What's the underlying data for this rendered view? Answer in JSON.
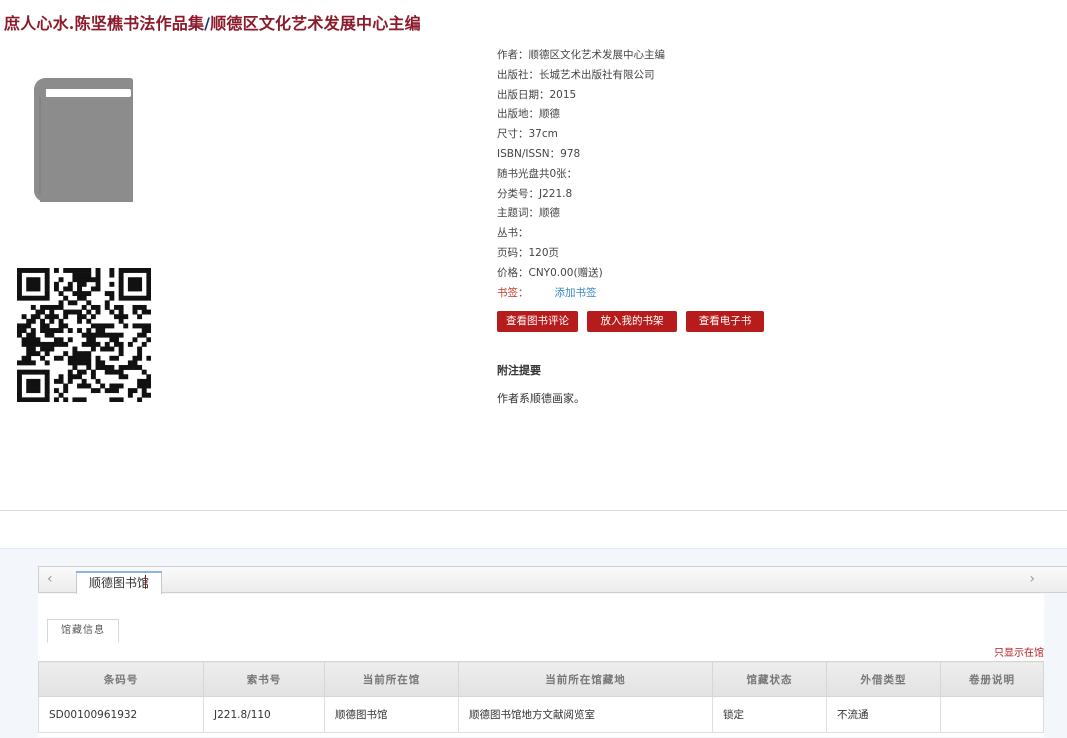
{
  "book": {
    "title_main": "庶人心水.陈坚樵书法作品集",
    "title_sep": "/",
    "title_resp": "顺德区文化艺术发展中心主编"
  },
  "meta": [
    {
      "label": "作者：",
      "value": "顺德区文化艺术发展中心主编"
    },
    {
      "label": "出版社：",
      "value": "长城艺术出版社有限公司"
    },
    {
      "label": "出版日期：",
      "value": "2015"
    },
    {
      "label": "出版地：",
      "value": "顺德"
    },
    {
      "label": "尺寸：",
      "value": "37cm"
    },
    {
      "label": "ISBN/ISSN：",
      "value": "978"
    },
    {
      "label": "随书光盘共0张：",
      "value": ""
    },
    {
      "label": "分类号：",
      "value": "J221.8"
    },
    {
      "label": "主题词：",
      "value": "顺德"
    },
    {
      "label": "丛书：",
      "value": ""
    },
    {
      "label": "页码：",
      "value": "120页"
    },
    {
      "label": "价格：",
      "value": "CNY0.00(赠送)"
    }
  ],
  "bookmark": {
    "label": "书签：",
    "link": "添加书签"
  },
  "actions": {
    "review": "查看图书评论",
    "shelf": "放入我的书架",
    "ebook": "查看电子书"
  },
  "notes": {
    "title": "附注提要",
    "text": "作者系顺德画家。"
  },
  "tabs": {
    "library": "顺德图书馆",
    "holdings": "馆藏信息",
    "only_available": "只显示在馆",
    "arrow_left": "‹",
    "arrow_right": "›"
  },
  "holdings": {
    "headers": [
      "条码号",
      "索书号",
      "当前所在馆",
      "当前所在馆藏地",
      "馆藏状态",
      "外借类型",
      "卷册说明"
    ],
    "rows": [
      [
        "SD00100961932",
        "J221.8/110",
        "顺德图书馆",
        "顺德图书馆地方文献阅览室",
        "锁定",
        "不流通",
        ""
      ]
    ]
  },
  "icons": {
    "cover": "book-cover-icon",
    "qr": "qr-code"
  },
  "colors": {
    "title": "#8b1a2b",
    "button": "#b71c1c",
    "link": "#3a86c8"
  }
}
